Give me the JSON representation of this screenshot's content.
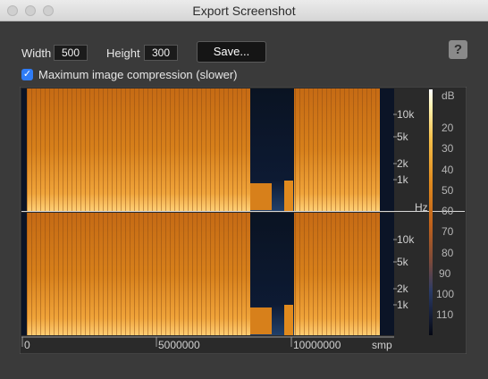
{
  "window": {
    "title": "Export Screenshot"
  },
  "toolbar": {
    "width_label": "Width",
    "width_value": "500",
    "height_label": "Height",
    "height_value": "300",
    "save_label": "Save...",
    "help_label": "?"
  },
  "compression": {
    "label": "Maximum image compression (slower)",
    "checked": true
  },
  "spectrogram": {
    "freq_ticks": [
      "10k",
      "5k",
      "2k",
      "1k"
    ],
    "freq_unit": "Hz",
    "time_ticks": [
      "0",
      "5000000",
      "10000000"
    ],
    "time_unit": "smp",
    "db_unit": "dB",
    "db_ticks": [
      "20",
      "30",
      "40",
      "50",
      "60",
      "70",
      "80",
      "90",
      "100",
      "110"
    ]
  },
  "colors": {
    "background": "#3a3a3a",
    "spectrogram_hot": "#e08a1e",
    "spectrogram_dark": "#0b1426",
    "accent": "#2f7cf6"
  }
}
